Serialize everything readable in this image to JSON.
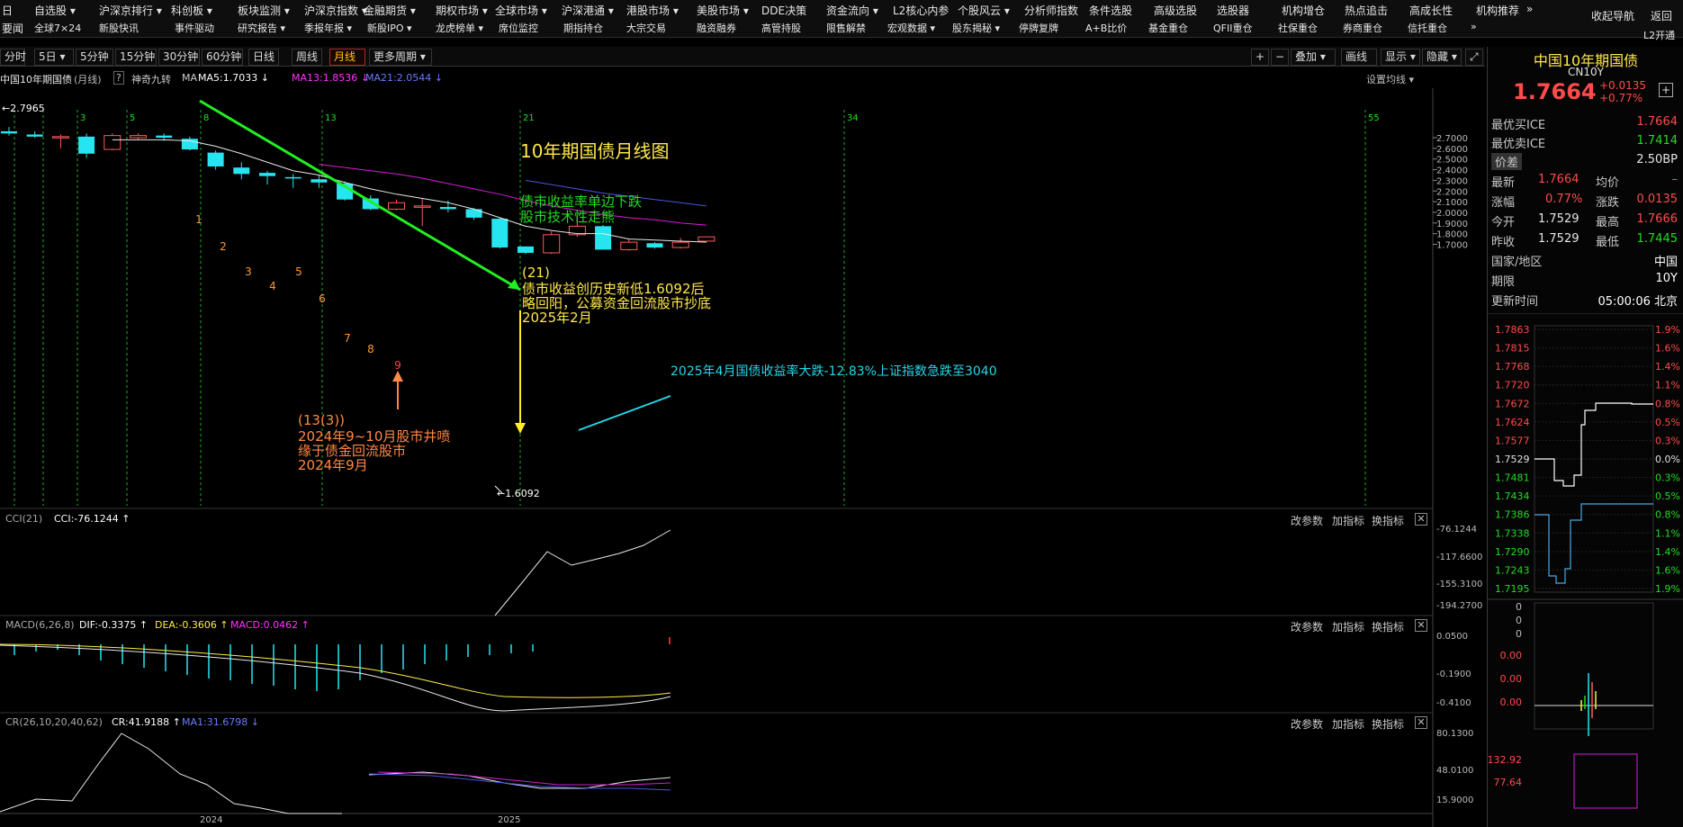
{
  "menu_row1": [
    "自选股 ▾",
    "沪深京排行 ▾",
    "科创板 ▾",
    "板块监测 ▾",
    "沪深京指数 ▾",
    "金融期货 ▾",
    "期权市场 ▾",
    "全球市场 ▾",
    "沪深港通 ▾",
    "港股市场 ▾",
    "美股市场 ▾",
    "DDE决策",
    "资金流向 ▾",
    "L2核心内参",
    "个股风云 ▾",
    "分析师指数",
    "条件选股",
    "高级选股",
    "选股器",
    "机构增仓",
    "热点追击",
    "高成长性",
    "机构推荐",
    "»"
  ],
  "menu_row2": [
    "全球7×24",
    "新股快讯",
    "事件驱动",
    "研究报告 ▾",
    "季报年报 ▾",
    "新股IPO ▾",
    "龙虎榜单 ▾",
    "席位监控",
    "期指持仓",
    "大宗交易",
    "融资融券",
    "高管持股",
    "限售解禁",
    "宏观数据 ▾",
    "股东揭秘 ▾",
    "停牌复牌",
    "A+B比价",
    "基金重仓",
    "QFII重仓",
    "社保重仓",
    "券商重仓",
    "信托重仓",
    "»"
  ],
  "menu_left_r1": "日",
  "menu_left_r2": "要闻",
  "menu_right_r1": [
    "收起导航",
    "返回"
  ],
  "menu_right_r2": "L2开通",
  "period_tabs": [
    "分时",
    "5日 ▾",
    "5分钟",
    "15分钟",
    "30分钟",
    "60分钟",
    "日线",
    "周线",
    "月线",
    "更多周期 ▾"
  ],
  "active_period": "月线",
  "toolbar_right": [
    "+",
    "−",
    "叠加 ▾",
    "画线",
    "显示 ▾",
    "隐藏 ▾"
  ],
  "chart_title": {
    "name": "中国10年期国债",
    "period": "(月线)",
    "help": "?",
    "indicator": "神奇九转",
    "ma_label": "MA",
    "ma5": "MA5:1.7033 ↓",
    "ma13": "MA13:1.8536 ↓",
    "ma21": "MA21:2.0544 ↓",
    "settings": "设置均线 ▾"
  },
  "annotations": {
    "main_title": "10年期国债月线图",
    "bond_text_1": "债市收益率单边下跌",
    "bond_text_2": "股市技术性走熊",
    "low_text_1": "(21)",
    "low_text_2": "债市收益创历史新低1.6092后",
    "low_text_3": "略回阳，公募资金回流股市抄底",
    "low_text_4": "2025年2月",
    "april_text": "2025年4月国债收益率大跌-12.83%上证指数急跌至3040",
    "sep_text_1": "(13(3))",
    "sep_text_2": "2024年9~10月股市井喷",
    "sep_text_3": "缘于债金回流股市",
    "sep_text_4": "2024年9月",
    "high_label": "←2.7965",
    "low_label": "←1.6092"
  },
  "fib_labels": [
    "3",
    "5",
    "8",
    "13",
    "21",
    "34",
    "55"
  ],
  "nine_labels": [
    "1",
    "2",
    "3",
    "4",
    "5",
    "6",
    "7",
    "8",
    "9"
  ],
  "x_axis": [
    "2024",
    "2025"
  ],
  "y_axis_main": [
    "2.7000",
    "2.6000",
    "2.5000",
    "2.4000",
    "2.3000",
    "2.2000",
    "2.1000",
    "2.0000",
    "1.9000",
    "1.8000",
    "1.7000"
  ],
  "cci": {
    "label": "CCI(21)",
    "value": "CCI:-76.1244 ↑",
    "axis": [
      "-76.1244",
      "-117.6600",
      "-155.3100",
      "-194.2700"
    ]
  },
  "macd": {
    "label": "MACD(6,26,8)",
    "dif": "DIF:-0.3375 ↑",
    "dea": "DEA:-0.3606 ↑",
    "macd": "MACD:0.0462 ↑",
    "axis": [
      "0.0500",
      "-0.1900",
      "-0.4100"
    ]
  },
  "cr": {
    "label": "CR(26,10,20,40,62)",
    "cr": "CR:41.9188 ↑",
    "ma1": "MA1:31.6798 ↓",
    "axis": [
      "80.1300",
      "48.0100",
      "15.9000"
    ]
  },
  "sub_buttons": [
    "改参数",
    "加指标",
    "换指标",
    "✕"
  ],
  "quote": {
    "name": "中国10年期国债",
    "code": "CN10Y",
    "price": "1.7664",
    "change": "+0.0135",
    "change_pct": "+0.77%",
    "best_buy_label": "最优买ICE",
    "best_buy": "1.7664",
    "best_sell_label": "最优卖ICE",
    "best_sell": "1.7414",
    "spread_label": "价差",
    "spread": "2.50BP",
    "latest_label": "最新",
    "latest": "1.7664",
    "avg_label": "均价",
    "avg": "–",
    "pct_label": "涨幅",
    "pct": "0.77%",
    "chg_label": "涨跌",
    "chg": "0.0135",
    "open_label": "今开",
    "open": "1.7529",
    "high_label": "最高",
    "high": "1.7666",
    "prev_label": "昨收",
    "prev": "1.7529",
    "low_label": "最低",
    "low": "1.7445",
    "country_label": "国家/地区",
    "country": "中国",
    "term_label": "期限",
    "term": "10Y",
    "update_label": "更新时间",
    "update": "05:00:06 北京"
  },
  "intraday_axis_left": [
    "1.7863",
    "1.7815",
    "1.7768",
    "1.7720",
    "1.7672",
    "1.7624",
    "1.7577",
    "1.7529",
    "1.7481",
    "1.7434",
    "1.7386",
    "1.7338",
    "1.7290",
    "1.7243",
    "1.7195"
  ],
  "intraday_axis_right": [
    "1.9%",
    "1.6%",
    "1.4%",
    "1.1%",
    "0.8%",
    "0.5%",
    "0.3%",
    "0.0%",
    "0.3%",
    "0.5%",
    "0.8%",
    "1.1%",
    "1.4%",
    "1.6%",
    "1.9%"
  ],
  "mini_axis": [
    "0",
    "0",
    "0",
    "0.00",
    "0.00",
    "0.00",
    "132.92",
    "77.64"
  ],
  "chart_data": {
    "type": "candlestick",
    "title": "10年期国债月线图",
    "y_range": [
      1.6,
      2.8
    ],
    "candles": [
      {
        "o": 2.76,
        "c": 2.74,
        "h": 2.8,
        "l": 2.72
      },
      {
        "o": 2.73,
        "c": 2.71,
        "h": 2.76,
        "l": 2.7
      },
      {
        "o": 2.71,
        "c": 2.71,
        "h": 2.73,
        "l": 2.6
      },
      {
        "o": 2.71,
        "c": 2.55,
        "h": 2.74,
        "l": 2.51
      },
      {
        "o": 2.59,
        "c": 2.72,
        "h": 2.74,
        "l": 2.58
      },
      {
        "o": 2.7,
        "c": 2.72,
        "h": 2.74,
        "l": 2.68
      },
      {
        "o": 2.72,
        "c": 2.7,
        "h": 2.74,
        "l": 2.67
      },
      {
        "o": 2.69,
        "c": 2.59,
        "h": 2.71,
        "l": 2.58
      },
      {
        "o": 2.56,
        "c": 2.43,
        "h": 2.58,
        "l": 2.4
      },
      {
        "o": 2.42,
        "c": 2.36,
        "h": 2.47,
        "l": 2.31
      },
      {
        "o": 2.37,
        "c": 2.34,
        "h": 2.39,
        "l": 2.26
      },
      {
        "o": 2.33,
        "c": 2.32,
        "h": 2.36,
        "l": 2.23
      },
      {
        "o": 2.31,
        "c": 2.28,
        "h": 2.35,
        "l": 2.23
      },
      {
        "o": 2.27,
        "c": 2.12,
        "h": 2.29,
        "l": 2.11
      },
      {
        "o": 2.13,
        "c": 2.03,
        "h": 2.16,
        "l": 2.02
      },
      {
        "o": 2.03,
        "c": 2.09,
        "h": 2.12,
        "l": 2.02
      },
      {
        "o": 2.06,
        "c": 2.06,
        "h": 2.13,
        "l": 1.87
      },
      {
        "o": 2.05,
        "c": 2.03,
        "h": 2.11,
        "l": 2.0
      },
      {
        "o": 2.03,
        "c": 1.95,
        "h": 2.04,
        "l": 1.93
      },
      {
        "o": 1.94,
        "c": 1.67,
        "h": 1.95,
        "l": 1.66
      },
      {
        "o": 1.68,
        "c": 1.62,
        "h": 1.68,
        "l": 1.61
      },
      {
        "o": 1.62,
        "c": 1.79,
        "h": 1.82,
        "l": 1.61
      },
      {
        "o": 1.79,
        "c": 1.87,
        "h": 1.97,
        "l": 1.77
      },
      {
        "o": 1.87,
        "c": 1.65,
        "h": 1.88,
        "l": 1.65
      },
      {
        "o": 1.65,
        "c": 1.72,
        "h": 1.75,
        "l": 1.64
      },
      {
        "o": 1.71,
        "c": 1.67,
        "h": 1.72,
        "l": 1.66
      },
      {
        "o": 1.67,
        "c": 1.72,
        "h": 1.76,
        "l": 1.66
      },
      {
        "o": 1.73,
        "c": 1.77,
        "h": 1.77,
        "l": 1.72
      }
    ],
    "ma5": [
      null,
      null,
      null,
      null,
      2.68,
      2.68,
      2.68,
      2.67,
      2.62,
      2.55,
      2.47,
      2.39,
      2.35,
      2.28,
      2.22,
      2.17,
      2.13,
      2.09,
      2.03,
      1.95,
      1.87,
      1.83,
      1.8,
      1.8,
      1.75,
      1.74,
      1.73,
      1.72
    ],
    "ma13": [
      null,
      null,
      null,
      null,
      null,
      null,
      null,
      null,
      null,
      null,
      null,
      null,
      2.45,
      2.42,
      2.39,
      2.36,
      2.32,
      2.27,
      2.22,
      2.17,
      2.11,
      2.06,
      2.02,
      1.98,
      1.95,
      1.93,
      1.9,
      1.88
    ],
    "ma21": [
      null,
      null,
      null,
      null,
      null,
      null,
      null,
      null,
      null,
      null,
      null,
      null,
      null,
      null,
      null,
      null,
      null,
      null,
      null,
      null,
      2.3,
      2.26,
      2.22,
      2.18,
      2.15,
      2.12,
      2.09,
      2.06
    ]
  }
}
